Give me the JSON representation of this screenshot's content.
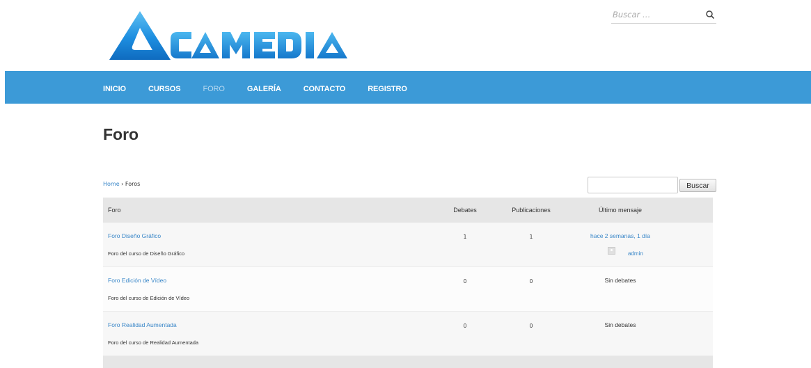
{
  "header": {
    "logo_text": "ACAMEDIA",
    "search": {
      "placeholder": "Buscar …",
      "value": ""
    }
  },
  "nav": {
    "items": [
      {
        "label": "INICIO",
        "active": false
      },
      {
        "label": "CURSOS",
        "active": false
      },
      {
        "label": "FORO",
        "active": true
      },
      {
        "label": "GALERÍA",
        "active": false
      },
      {
        "label": "CONTACTO",
        "active": false
      },
      {
        "label": "REGISTRO",
        "active": false
      }
    ]
  },
  "page": {
    "title": "Foro"
  },
  "breadcrumb": {
    "home": "Home",
    "separator": " › ",
    "current": "Foros"
  },
  "forum_search": {
    "value": "",
    "button_label": "Buscar"
  },
  "table": {
    "headers": {
      "forum": "Foro",
      "topics": "Debates",
      "posts": "Publicaciones",
      "last": "Último mensaje"
    },
    "rows": [
      {
        "title": "Foro Diseño Gráfico",
        "description": "Foro del curso de Diseño Gráfico",
        "topics": "1",
        "posts": "1",
        "last_post": "hace 2 semanas, 1 día",
        "last_user": "admin"
      },
      {
        "title": "Foro Edición de Vídeo",
        "description": "Foro del curso de Edición de Vídeo",
        "topics": "0",
        "posts": "0",
        "last_post": "Sin debates",
        "last_user": ""
      },
      {
        "title": "Foro Realidad Aumentada",
        "description": "Foro del curso de Realidad Aumentada",
        "topics": "0",
        "posts": "0",
        "last_post": "Sin debates",
        "last_user": ""
      }
    ]
  },
  "colors": {
    "nav_bg": "#3c9ad7",
    "link": "#3a87c8",
    "logo_blue": "#1f86d6"
  }
}
